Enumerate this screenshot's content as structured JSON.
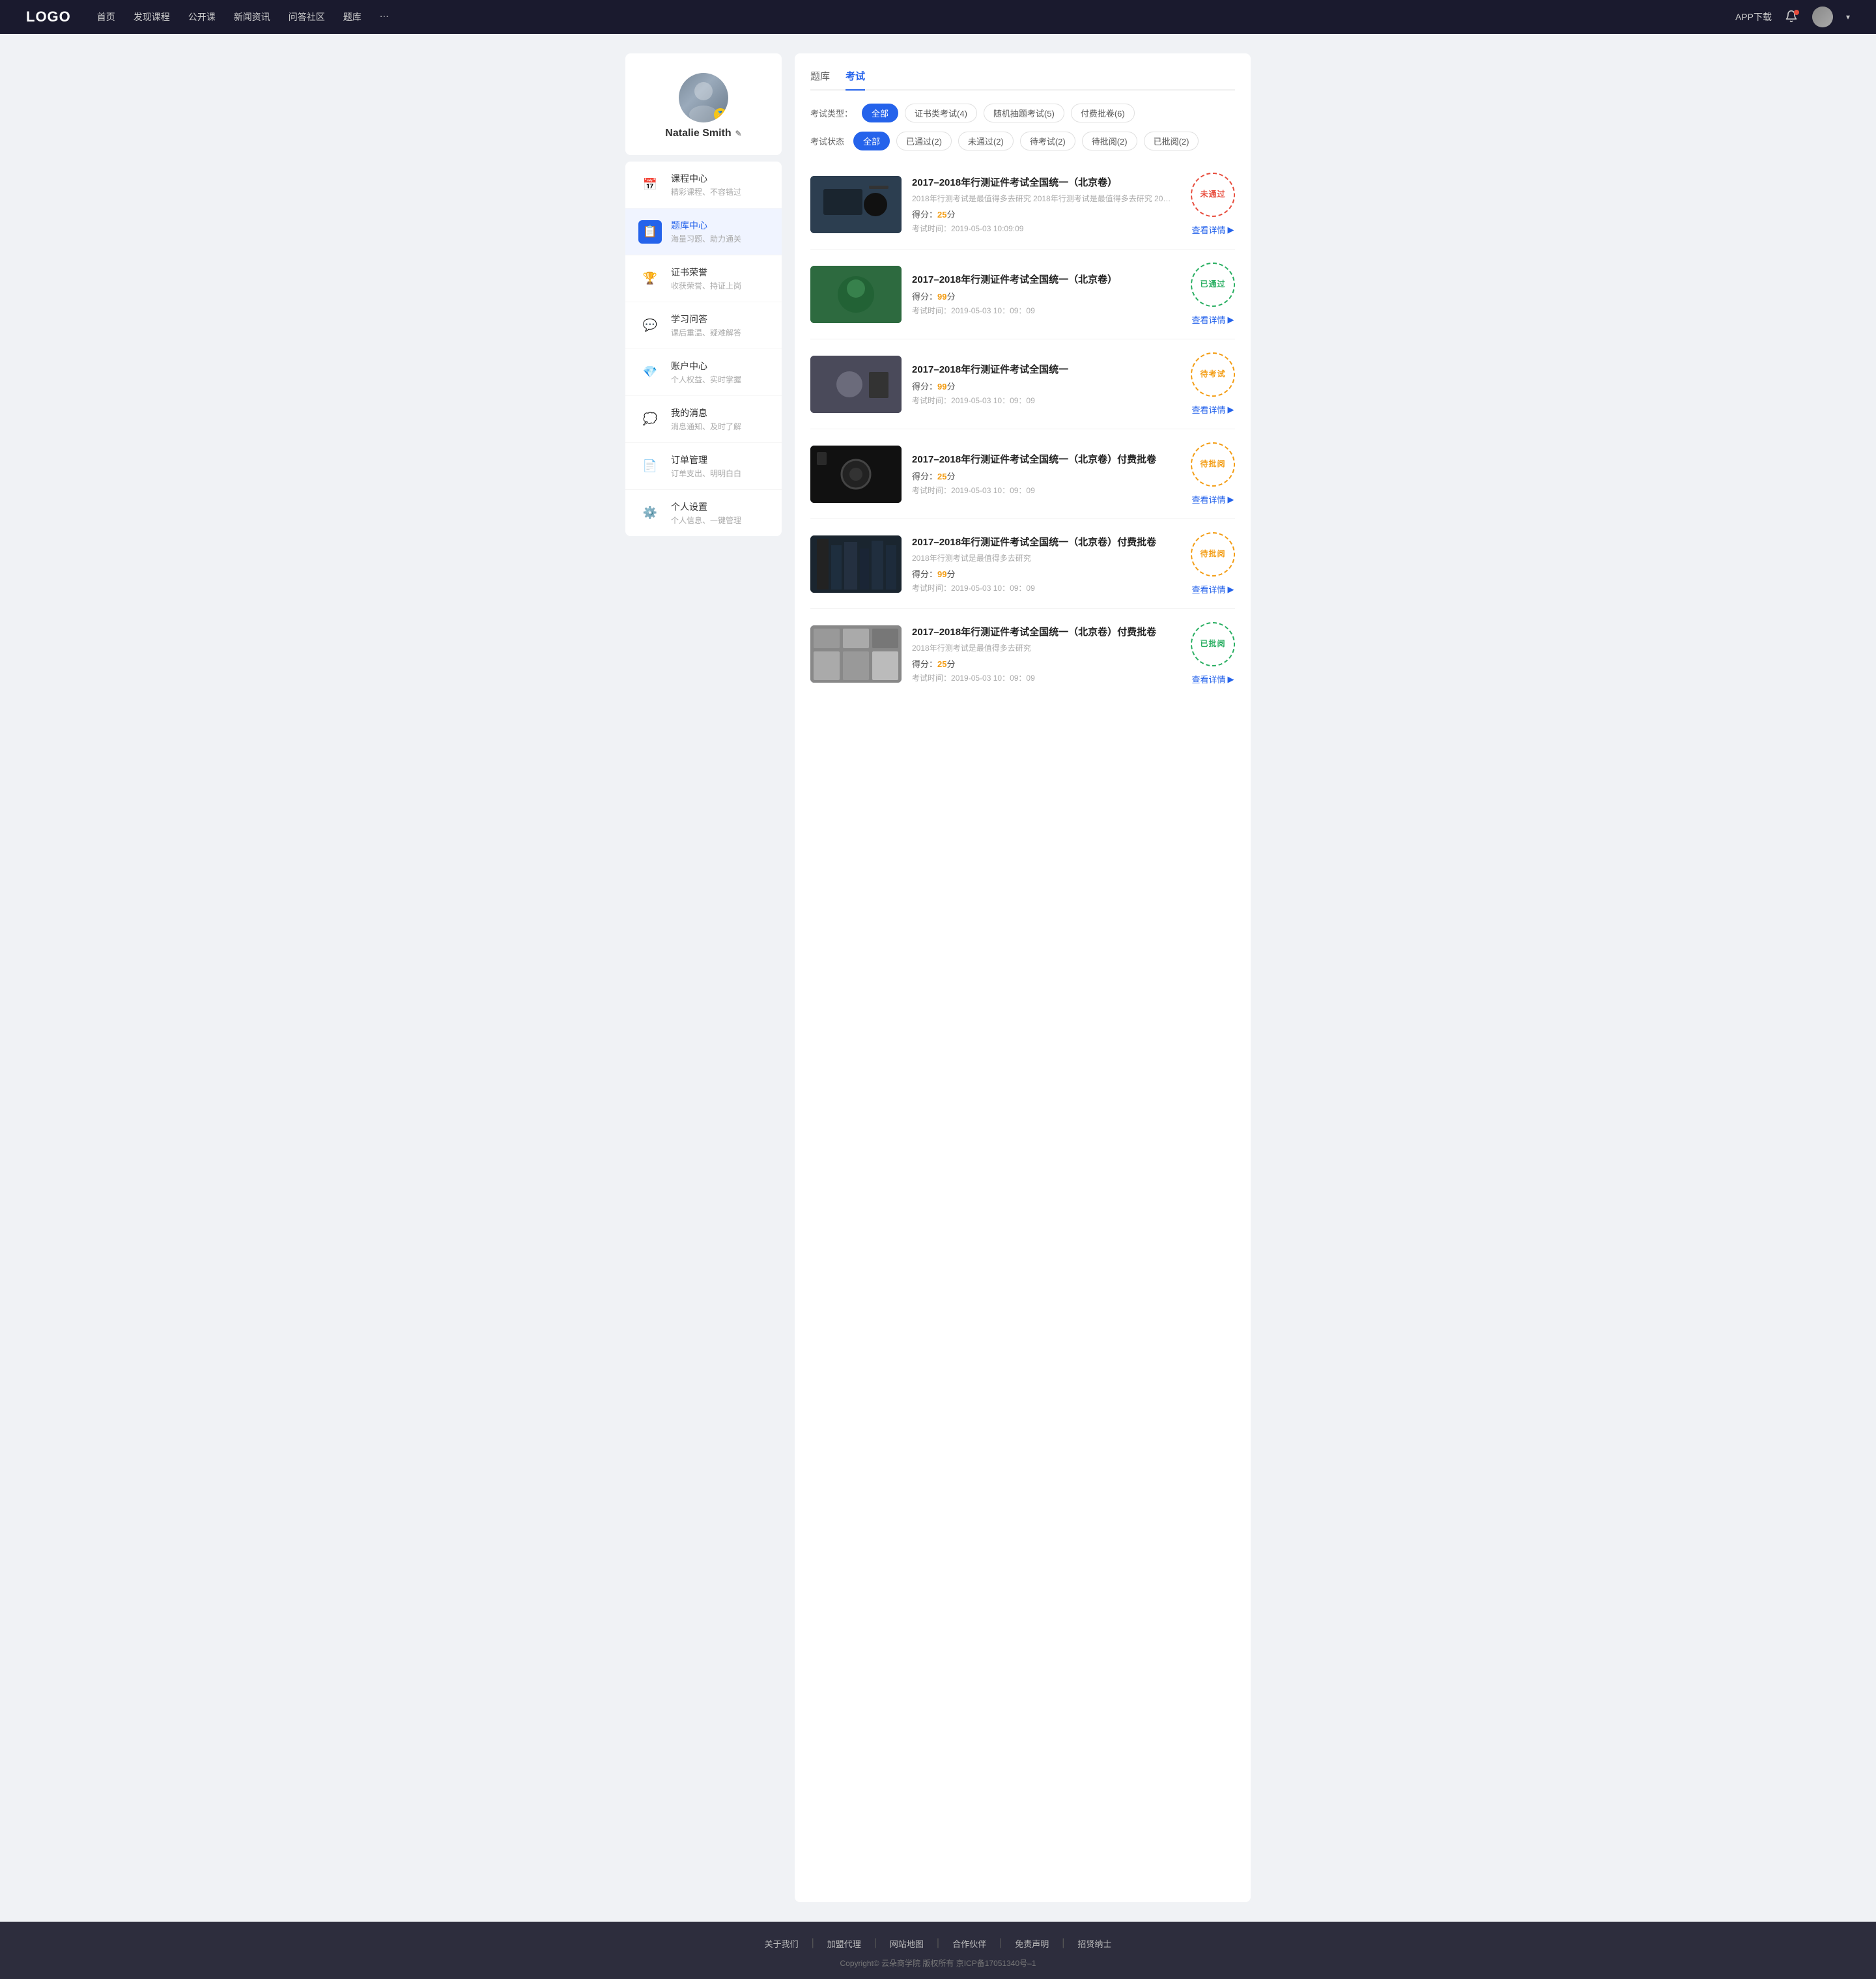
{
  "header": {
    "logo": "LOGO",
    "nav": [
      {
        "label": "首页",
        "id": "home"
      },
      {
        "label": "发现课程",
        "id": "discover"
      },
      {
        "label": "公开课",
        "id": "open"
      },
      {
        "label": "新闻资讯",
        "id": "news"
      },
      {
        "label": "问答社区",
        "id": "qa"
      },
      {
        "label": "题库",
        "id": "bank"
      },
      {
        "label": "···",
        "id": "more"
      }
    ],
    "app_download": "APP下载",
    "chevron": "▾"
  },
  "sidebar": {
    "profile": {
      "name": "Natalie Smith",
      "badge": "🏅"
    },
    "menu": [
      {
        "id": "course-center",
        "icon": "📅",
        "label": "课程中心",
        "desc": "精彩课程、不容错过",
        "active": false
      },
      {
        "id": "question-bank",
        "icon": "📋",
        "label": "题库中心",
        "desc": "海量习题、助力通关",
        "active": true
      },
      {
        "id": "certificate",
        "icon": "🏆",
        "label": "证书荣誉",
        "desc": "收获荣誉、持证上岗",
        "active": false
      },
      {
        "id": "qa-center",
        "icon": "💬",
        "label": "学习问答",
        "desc": "课后重温、疑难解答",
        "active": false
      },
      {
        "id": "account",
        "icon": "💎",
        "label": "账户中心",
        "desc": "个人权益、实时掌握",
        "active": false
      },
      {
        "id": "messages",
        "icon": "💭",
        "label": "我的消息",
        "desc": "消息通知、及时了解",
        "active": false
      },
      {
        "id": "orders",
        "icon": "📄",
        "label": "订单管理",
        "desc": "订单支出、明明白白",
        "active": false
      },
      {
        "id": "settings",
        "icon": "⚙️",
        "label": "个人设置",
        "desc": "个人信息、一键管理",
        "active": false
      }
    ]
  },
  "content": {
    "tabs": [
      {
        "label": "题库",
        "id": "bank",
        "active": false
      },
      {
        "label": "考试",
        "id": "exam",
        "active": true
      }
    ],
    "filter_type": {
      "label": "考试类型：",
      "options": [
        {
          "label": "全部",
          "active": true
        },
        {
          "label": "证书类考试(4)",
          "active": false
        },
        {
          "label": "随机抽题考试(5)",
          "active": false
        },
        {
          "label": "付费批卷(6)",
          "active": false
        }
      ]
    },
    "filter_status": {
      "label": "考试状态",
      "options": [
        {
          "label": "全部",
          "active": true
        },
        {
          "label": "已通过(2)",
          "active": false
        },
        {
          "label": "未通过(2)",
          "active": false
        },
        {
          "label": "待考试(2)",
          "active": false
        },
        {
          "label": "待批阅(2)",
          "active": false
        },
        {
          "label": "已批阅(2)",
          "active": false
        }
      ]
    },
    "exams": [
      {
        "id": "exam-1",
        "title": "2017–2018年行测证件考试全国统一（北京卷）",
        "desc": "2018年行测考试是最值得多去研究 2018年行测考试是最值得多去研究 2018年行...",
        "score_label": "得分：",
        "score": "25",
        "score_unit": "分",
        "time_label": "考试时间：",
        "time": "2019-05-03  10:09:09",
        "stamp_text": "未通过",
        "stamp_type": "fail",
        "btn_label": "查看详情",
        "thumb_class": "thumb-1"
      },
      {
        "id": "exam-2",
        "title": "2017–2018年行测证件考试全国统一（北京卷）",
        "desc": "",
        "score_label": "得分：",
        "score": "99",
        "score_unit": "分",
        "time_label": "考试时间：",
        "time": "2019-05-03  10：09：09",
        "stamp_text": "已通过",
        "stamp_type": "pass",
        "btn_label": "查看详情",
        "thumb_class": "thumb-2"
      },
      {
        "id": "exam-3",
        "title": "2017–2018年行测证件考试全国统一",
        "desc": "",
        "score_label": "得分：",
        "score": "99",
        "score_unit": "分",
        "time_label": "考试时间：",
        "time": "2019-05-03  10：09：09",
        "stamp_text": "待考试",
        "stamp_type": "pending",
        "btn_label": "查看详情",
        "thumb_class": "thumb-3"
      },
      {
        "id": "exam-4",
        "title": "2017–2018年行测证件考试全国统一（北京卷）付费批卷",
        "desc": "",
        "score_label": "得分：",
        "score": "25",
        "score_unit": "分",
        "time_label": "考试时间：",
        "time": "2019-05-03  10：09：09",
        "stamp_text": "待批阅",
        "stamp_type": "wait-review",
        "btn_label": "查看详情",
        "thumb_class": "thumb-4"
      },
      {
        "id": "exam-5",
        "title": "2017–2018年行测证件考试全国统一（北京卷）付费批卷",
        "desc": "2018年行测考试是最值得多去研究",
        "score_label": "得分：",
        "score": "99",
        "score_unit": "分",
        "time_label": "考试时间：",
        "time": "2019-05-03  10：09：09",
        "stamp_text": "待批阅",
        "stamp_type": "wait-review",
        "btn_label": "查看详情",
        "thumb_class": "thumb-5"
      },
      {
        "id": "exam-6",
        "title": "2017–2018年行测证件考试全国统一（北京卷）付费批卷",
        "desc": "2018年行测考试是最值得多去研究",
        "score_label": "得分：",
        "score": "25",
        "score_unit": "分",
        "time_label": "考试时间：",
        "time": "2019-05-03  10：09：09",
        "stamp_text": "已批阅",
        "stamp_type": "reviewed",
        "btn_label": "查看详情",
        "thumb_class": "thumb-6"
      }
    ]
  },
  "footer": {
    "links": [
      {
        "label": "关于我们"
      },
      {
        "label": "加盟代理"
      },
      {
        "label": "网站地图"
      },
      {
        "label": "合作伙伴"
      },
      {
        "label": "免责声明"
      },
      {
        "label": "招贤纳士"
      }
    ],
    "copyright": "Copyright© 云朵商学院  版权所有    京ICP备17051340号–1"
  }
}
